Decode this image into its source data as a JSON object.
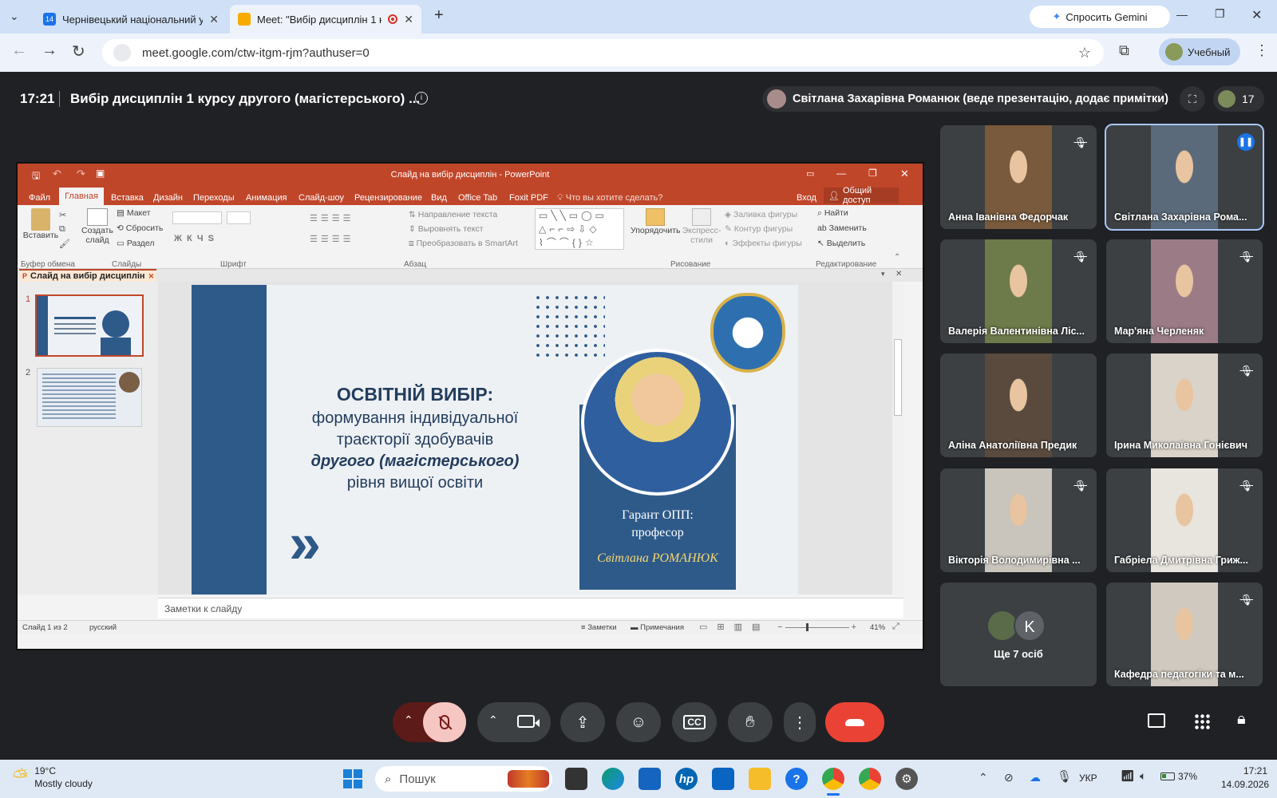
{
  "browser": {
    "tabs": [
      {
        "title": "Чернівецький національний у",
        "fav_text": "14"
      },
      {
        "title": "Meet: \"Вибір дисциплін 1 к",
        "fav_text": ""
      }
    ],
    "new_tab": "+",
    "gemini": "Спросить Gemini",
    "url": "meet.google.com/ctw-itgm-rjm?authuser=0",
    "profile": "Учебный"
  },
  "meet": {
    "time": "17:21",
    "title": "Вибір дисциплін 1 курсу другого (магістерського) ...",
    "presenter": "Світлана Захарівна Романюк (веде презентацію, додає примітки)",
    "participants_count": "17",
    "others_label": "Ще 7 осіб",
    "others_initial": "K",
    "tiles": [
      {
        "name": "Анна Іванівна Федорчак",
        "muted": true,
        "color": "#7a5a3c"
      },
      {
        "name": "Світлана Захарівна Рома...",
        "muted": false,
        "color": "#5b6a7a"
      },
      {
        "name": "Валерія Валентинівна Ліс...",
        "muted": true,
        "color": "#6d7a4a"
      },
      {
        "name": "Мар'яна Черленяк",
        "muted": true,
        "color": "#9a7b86"
      },
      {
        "name": "Аліна Анатоліївна Предик",
        "muted": false,
        "color": "#5a4a3e"
      },
      {
        "name": "Ірина Миколаївна Гонієвич",
        "muted": true,
        "color": "#d9d3c9"
      },
      {
        "name": "Вікторія Володимирівна ...",
        "muted": true,
        "color": "#c9c4bc"
      },
      {
        "name": "Габріела Дмитрівна Гриж...",
        "muted": true,
        "color": "#e8e4de"
      },
      {
        "name": "Кафедра педагогіки та м...",
        "muted": true,
        "color": "#cfc9bf"
      }
    ]
  },
  "ppt": {
    "window_title": "Слайд на вибір дисциплін - PowerPoint",
    "tabs": [
      "Файл",
      "Главная",
      "Вставка",
      "Дизайн",
      "Переходы",
      "Анимация",
      "Слайд-шоу",
      "Рецензирование",
      "Вид",
      "Office Tab",
      "Foxit PDF"
    ],
    "tell_me": "Что вы хотите сделать?",
    "signin": "Вход",
    "share": "Общий доступ",
    "groups": [
      "Буфер обмена",
      "Слайды",
      "Шрифт",
      "Абзац",
      "Рисование",
      "Редактирование"
    ],
    "ribbon": {
      "paste": "Вставить",
      "new_slide": "Создать слайд",
      "layout": "Макет",
      "reset": "Сбросить",
      "section": "Раздел",
      "text_dir": "Направление текста",
      "align_text": "Выровнять текст",
      "smartart": "Преобразовать в SmartArt",
      "arrange": "Упорядочить",
      "quick_styles": "Экспресс-стили",
      "fill": "Заливка фигуры",
      "outline": "Контур фигуры",
      "effects": "Эффекты фигуры",
      "find": "Найти",
      "replace": "Заменить",
      "select": "Выделить"
    },
    "doc_tab": "Слайд на вибір дисциплін",
    "notes": "Заметки к слайду",
    "status_left": "Слайд 1 из 2",
    "lang": "русский",
    "notes_btn": "Заметки",
    "comments_btn": "Примечания",
    "zoom": "41%",
    "slide": {
      "title": "ОСВІТНІЙ ВИБІР",
      "line1": "формування індивідуальної",
      "line2": "траєкторії здобувачів",
      "line3": "другого (магістерського)",
      "line4": "рівня вищої освіти",
      "guarantor": "Гарант ОПП:",
      "position": "професор",
      "person": "Світлана РОМАНЮК"
    }
  },
  "taskbar": {
    "temp": "19°C",
    "weather": "Mostly cloudy",
    "search": "Пошук",
    "lang": "УКР",
    "battery": "37%",
    "time": "17:21",
    "date": "14.09.2026"
  }
}
